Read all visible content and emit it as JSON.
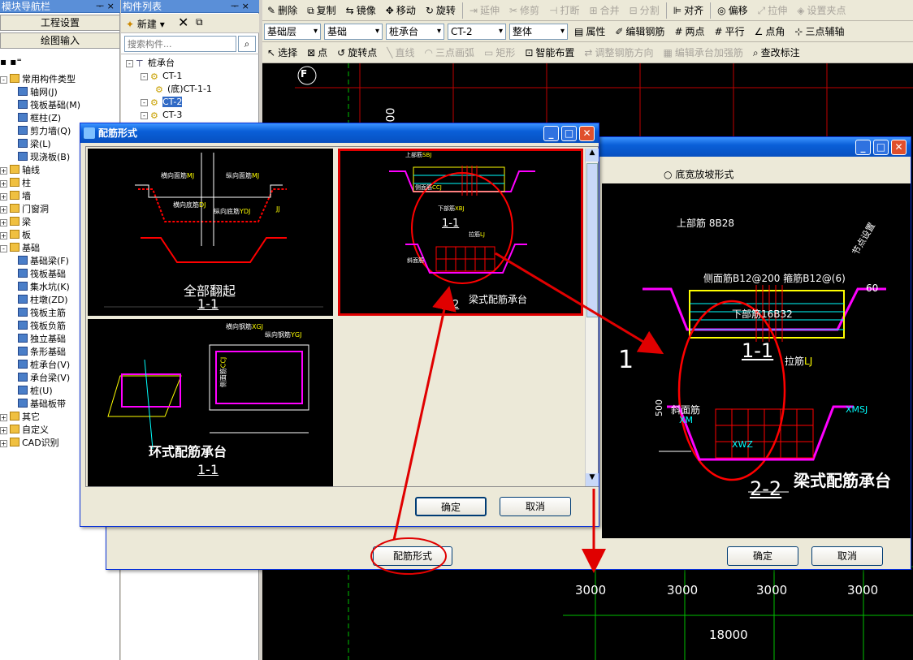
{
  "nav_panel": {
    "title": "模块导航栏",
    "pin": "ᅮ ×",
    "project_settings": "工程设置",
    "drawing_input": "绘图输入"
  },
  "nav_tree": [
    {
      "label": "常用构件类型",
      "level": 0,
      "type": "open-folder"
    },
    {
      "label": "轴网(J)",
      "level": 1
    },
    {
      "label": "筏板基础(M)",
      "level": 1
    },
    {
      "label": "框柱(Z)",
      "level": 1
    },
    {
      "label": "剪力墙(Q)",
      "level": 1
    },
    {
      "label": "梁(L)",
      "level": 1
    },
    {
      "label": "现浇板(B)",
      "level": 1
    },
    {
      "label": "轴线",
      "level": 0,
      "type": "folder"
    },
    {
      "label": "柱",
      "level": 0,
      "type": "folder"
    },
    {
      "label": "墙",
      "level": 0,
      "type": "folder"
    },
    {
      "label": "门窗洞",
      "level": 0,
      "type": "folder"
    },
    {
      "label": "梁",
      "level": 0,
      "type": "folder"
    },
    {
      "label": "板",
      "level": 0,
      "type": "folder"
    },
    {
      "label": "基础",
      "level": 0,
      "type": "open-folder"
    },
    {
      "label": "基础梁(F)",
      "level": 1
    },
    {
      "label": "筏板基础",
      "level": 1
    },
    {
      "label": "集水坑(K)",
      "level": 1
    },
    {
      "label": "柱墩(ZD)",
      "level": 1
    },
    {
      "label": "筏板主筋",
      "level": 1
    },
    {
      "label": "筏板负筋",
      "level": 1
    },
    {
      "label": "独立基础",
      "level": 1
    },
    {
      "label": "条形基础",
      "level": 1
    },
    {
      "label": "桩承台(V)",
      "level": 1
    },
    {
      "label": "承台梁(V)",
      "level": 1
    },
    {
      "label": "桩(U)",
      "level": 1
    },
    {
      "label": "基础板带",
      "level": 1
    },
    {
      "label": "其它",
      "level": 0,
      "type": "folder"
    },
    {
      "label": "自定义",
      "level": 0,
      "type": "folder"
    },
    {
      "label": "CAD识别",
      "level": 0,
      "type": "folder"
    }
  ],
  "component_panel": {
    "title": "构件列表",
    "pin": "ᅮ ×",
    "new_label": "新建",
    "search_placeholder": "搜索构件...",
    "tree": [
      {
        "label": "桩承台",
        "level": 0
      },
      {
        "label": "CT-1",
        "level": 1
      },
      {
        "label": "(底)CT-1-1",
        "level": 2
      },
      {
        "label": "CT-2",
        "level": 1,
        "selected": true
      },
      {
        "label": "CT-3",
        "level": 1
      }
    ]
  },
  "toolbar1": [
    "删除",
    "复制",
    "镜像",
    "移动",
    "旋转",
    "延伸",
    "修剪",
    "打断",
    "合并",
    "分割",
    "对齐",
    "偏移",
    "拉伸",
    "设置夹点"
  ],
  "toolbar1_disabled": [
    "延伸",
    "修剪",
    "打断",
    "合并",
    "分割",
    "拉伸",
    "设置夹点"
  ],
  "toolbar2": {
    "combos": [
      "基础层",
      "基础",
      "桩承台",
      "CT-2",
      "整体"
    ],
    "items": [
      "属性",
      "编辑钢筋",
      "两点",
      "平行",
      "点角",
      "三点辅轴"
    ]
  },
  "toolbar3": [
    "选择",
    "点",
    "旋转点",
    "直线",
    "三点画弧",
    "矩形",
    "智能布置",
    "调整钢筋方向",
    "编辑承台加强筋",
    "查改标注"
  ],
  "toolbar3_disabled": [
    "直线",
    "三点画弧",
    "矩形",
    "调整钢筋方向",
    "编辑承台加强筋"
  ],
  "axis_marker": "F",
  "cad_dim_vertical": "000",
  "back_dialog": {
    "radio": "底宽放坡形式",
    "confirm": "确定",
    "cancel": "取消",
    "peijin": "配筋形式",
    "labels": {
      "top": "上部筋",
      "top_val": "8B28",
      "side": "侧面筋",
      "side_val": "B12@200",
      "stirrup": "箍筋",
      "stirrup_val": "B12@",
      "n6": "(6)",
      "bottom": "下部筋",
      "bottom_val": "16B32",
      "angle": "60",
      "sec1": "1-1",
      "la": "拉筋",
      "la_code": "LJ",
      "slope": "斜面筋",
      "xm": "XM",
      "xmsj": "XMSJ",
      "xwz": "XWZ",
      "h500": "500",
      "sec2": "2-2",
      "title": "梁式配筋承台",
      "big1": "1",
      "node": "节点设置"
    }
  },
  "front_dialog": {
    "title": "配筋形式",
    "confirm": "确定",
    "cancel": "取消",
    "cell1": {
      "caption": "全部翻起",
      "section": "1-1",
      "l1": "横向面筋",
      "l1c": "MJ",
      "l2": "纵向面筋",
      "l2c": "MJ",
      "l3": "横向底筋",
      "l3c": "DJ",
      "l4": "纵向底筋",
      "l4c": "YDJ",
      "l5": "JJ"
    },
    "cell2": {
      "caption": "梁式配筋承台",
      "top": "上部筋",
      "topc": "SBJ",
      "side": "侧面筋",
      "sidec": "CCJ",
      "bottom": "下部筋",
      "bottomc": "XBJ",
      "sec": "1-1",
      "la": "拉筋",
      "lac": "LJ",
      "slope": "斜面筋",
      "sec2": "2-2"
    },
    "cell3": {
      "caption": "环式配筋承台",
      "section": "1-1",
      "l1": "横向钢筋",
      "l1c": "XGJ",
      "l2": "纵向钢筋",
      "l2c": "YGJ",
      "side": "侧面筋",
      "sidec": "CCJ"
    }
  },
  "grid_dims": {
    "top": [
      "3000",
      "3000",
      "3000",
      "3000"
    ],
    "total": "18000"
  }
}
